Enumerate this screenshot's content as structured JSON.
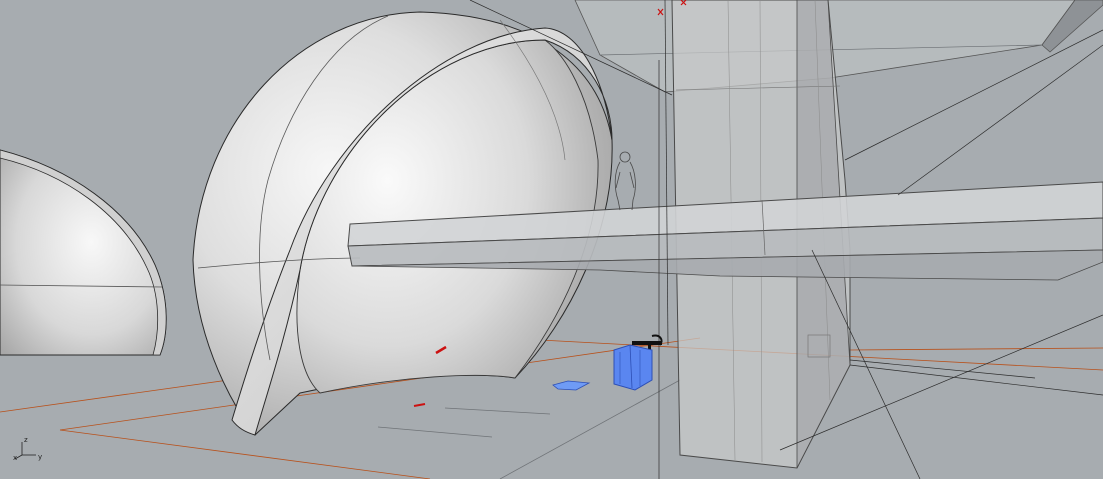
{
  "viewport": {
    "projection": "perspective",
    "display_mode": "shaded",
    "background_color": "#a7acb0",
    "gizmo": {
      "x_label": "x",
      "y_label": "y",
      "z_label": "z"
    }
  },
  "scene_objects": [
    {
      "name": "left-dome-shell"
    },
    {
      "name": "main-dome-shell"
    },
    {
      "name": "tower-column"
    },
    {
      "name": "horizontal-beam"
    },
    {
      "name": "upper-slab"
    },
    {
      "name": "human-figure"
    },
    {
      "name": "blue-block"
    },
    {
      "name": "blue-slab"
    }
  ],
  "colors": {
    "construction_lines": "#b8501a",
    "selection_marks": "#cc1111",
    "selected_object": "#5a86f0"
  }
}
